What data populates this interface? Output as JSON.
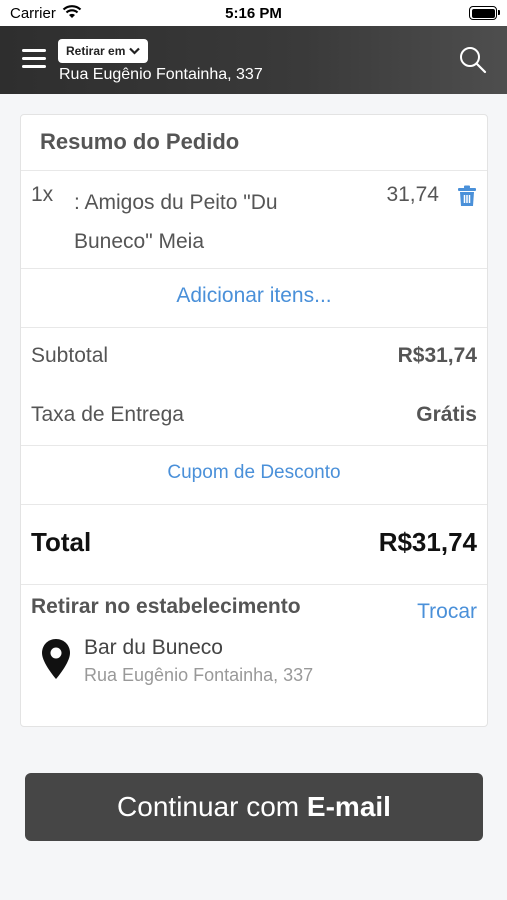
{
  "status_bar": {
    "carrier": "Carrier",
    "time": "5:16 PM"
  },
  "header": {
    "mode_label": "Retirar em",
    "address": "Rua Eugênio Fontainha, 337",
    "icons": [
      "menu-icon",
      "chevron-down-icon",
      "search-icon"
    ]
  },
  "order": {
    "title": "Resumo do Pedido",
    "item": {
      "qty": "1x",
      "name": ": Amigos du Peito \"Du Buneco\" Meia",
      "price": "31,74",
      "icon": "trash-icon"
    },
    "add_items": "Adicionar itens...",
    "subtotal_label": "Subtotal",
    "subtotal_value": "R$31,74",
    "delivery_label": "Taxa de Entrega",
    "delivery_value": "Grátis",
    "coupon": "Cupom de Desconto",
    "total_label": "Total",
    "total_value": "R$31,74"
  },
  "pickup": {
    "title": "Retirar no estabelecimento",
    "change": "Trocar",
    "store_name": "Bar du Buneco",
    "store_address": "Rua Eugênio Fontainha, 337",
    "icon": "location-pin-icon"
  },
  "cta": {
    "prefix": "Continuar com ",
    "bold": "E-mail"
  },
  "colors": {
    "accent": "#4a90d9",
    "header": "#333333",
    "button": "#464646"
  }
}
